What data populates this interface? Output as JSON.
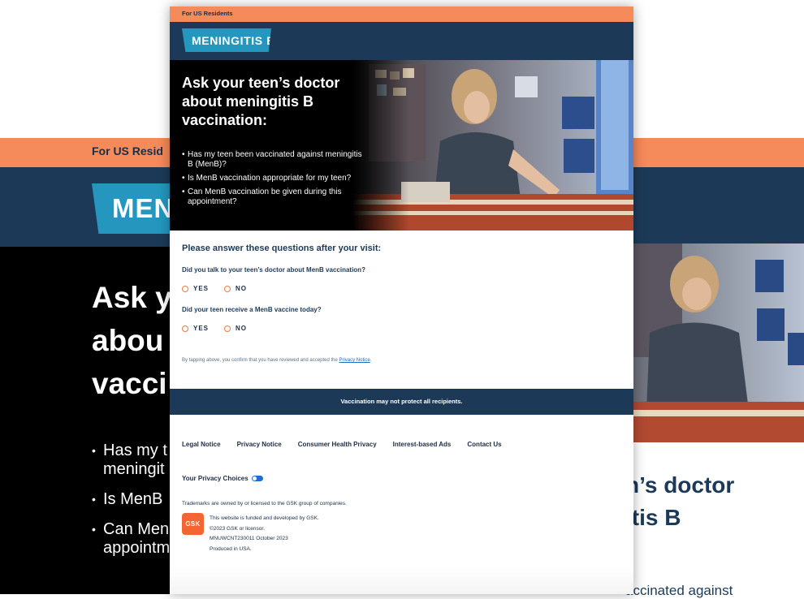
{
  "background_page": {
    "top_bar_text": "For US Resid",
    "logo_text": "MENI",
    "headline": [
      "Ask y",
      "abou",
      "vacci"
    ],
    "bullets": [
      "Has my t",
      "meningit",
      "Is MenB",
      "Can Men",
      "appointm"
    ],
    "right_heading_lines": [
      "n’s doctor",
      "itis B"
    ],
    "right_text": "accinated against"
  },
  "card": {
    "top_bar_text": "For US Residents",
    "logo_text": "MENINGITIS B",
    "hero": {
      "headline": "Ask your teen’s doctor about meningitis B vaccination:",
      "bullets": [
        "Has my teen been vaccinated against meningitis B (MenB)?",
        "Is MenB vaccination appropriate for my teen?",
        "Can MenB vaccination be given during this appointment?"
      ]
    },
    "survey": {
      "title": "Please answer these questions after your visit:",
      "q1": "Did you talk to your teen’s doctor about MenB vaccination?",
      "q2": "Did your teen receive a MenB vaccine today?",
      "yes_label": "YES",
      "no_label": "NO"
    },
    "consent": {
      "text": "By tapping above, you confirm that you have reviewed and accepted the ",
      "link": "Privacy Notice",
      "end": "."
    },
    "notice_bar": "Vaccination may not protect all recipients.",
    "footer": {
      "links": [
        "Legal Notice",
        "Privacy Notice",
        "Consumer Health Privacy",
        "Interest-based Ads",
        "Contact Us"
      ],
      "privacy_choices": "Your Privacy Choices",
      "trademark": "Trademarks are owned by or licensed to the GSK group of companies.",
      "gsk_logo_text": "GSK",
      "fine_print": [
        "This website is funded and developed by GSK.",
        "©2023 GSK or licensor.",
        "MNUWCNT230011 October 2023",
        "Produced in USA."
      ]
    }
  },
  "colors": {
    "orange": "#f58a5a",
    "navy": "#1c3a57",
    "logo_blue": "#2596be",
    "gsk_orange": "#f36633"
  }
}
